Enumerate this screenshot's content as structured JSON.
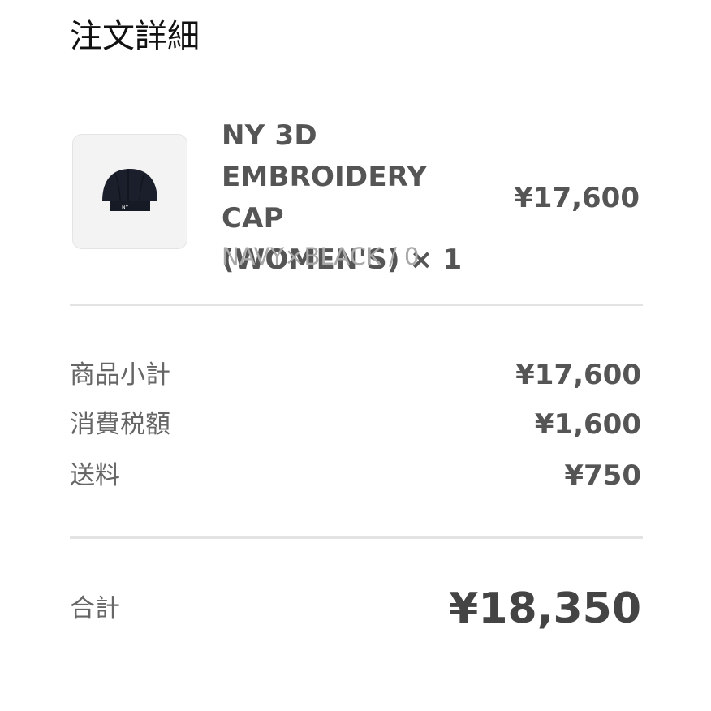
{
  "header": {
    "title": "注文詳細"
  },
  "item": {
    "image_name": "cap-product-image",
    "name": "NY 3D\nEMBROIDERY CAP\n(WOMEN'S) × 1",
    "variant": "NAVY×BLACK / 0",
    "price": "¥17,600",
    "image_text": "NY"
  },
  "summary": {
    "rows": [
      {
        "label": "商品小計",
        "value": "¥17,600"
      },
      {
        "label": "消費税額",
        "value": "¥1,600"
      },
      {
        "label": "送料",
        "value": "¥750"
      }
    ]
  },
  "total": {
    "label": "合計",
    "value": "¥18,350"
  },
  "colors": {
    "text_dark": "#111111",
    "text_medium": "#555555",
    "text_light": "#a8a8a8",
    "divider": "#e3e3e3",
    "thumb_bg": "#f3f3f3",
    "cap": "#1b1f2b"
  }
}
